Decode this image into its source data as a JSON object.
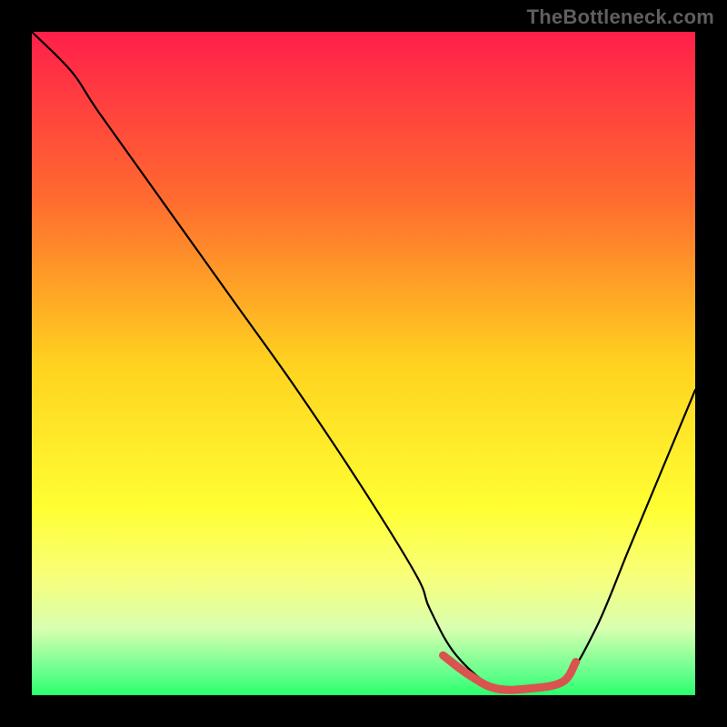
{
  "watermark": "TheBottleneck.com",
  "chart_data": {
    "type": "line",
    "title": "",
    "xlabel": "",
    "ylabel": "",
    "xlim": [
      0,
      100
    ],
    "ylim": [
      0,
      100
    ],
    "gradient_stops": [
      {
        "offset": 0.0,
        "color": "#ff1f4a"
      },
      {
        "offset": 0.25,
        "color": "#ff6a2f"
      },
      {
        "offset": 0.5,
        "color": "#ffd21f"
      },
      {
        "offset": 0.72,
        "color": "#ffff33"
      },
      {
        "offset": 0.82,
        "color": "#f8ff7a"
      },
      {
        "offset": 0.9,
        "color": "#d8ffb0"
      },
      {
        "offset": 0.97,
        "color": "#60ff8a"
      },
      {
        "offset": 1.0,
        "color": "#2aff6a"
      }
    ],
    "series": [
      {
        "name": "bottleneck-curve",
        "x": [
          0,
          6,
          10,
          20,
          30,
          40,
          50,
          58,
          60,
          64,
          70,
          75,
          80,
          85,
          90,
          95,
          100
        ],
        "y": [
          100,
          94,
          88,
          74,
          60,
          46,
          31,
          18,
          13,
          6,
          1,
          1,
          2,
          10,
          22,
          34,
          46
        ]
      }
    ],
    "highlight": {
      "name": "optimal-region",
      "color": "#d9534f",
      "x": [
        62,
        66,
        70,
        75,
        80,
        82
      ],
      "y": [
        6,
        3,
        1,
        1,
        2,
        5
      ]
    }
  }
}
